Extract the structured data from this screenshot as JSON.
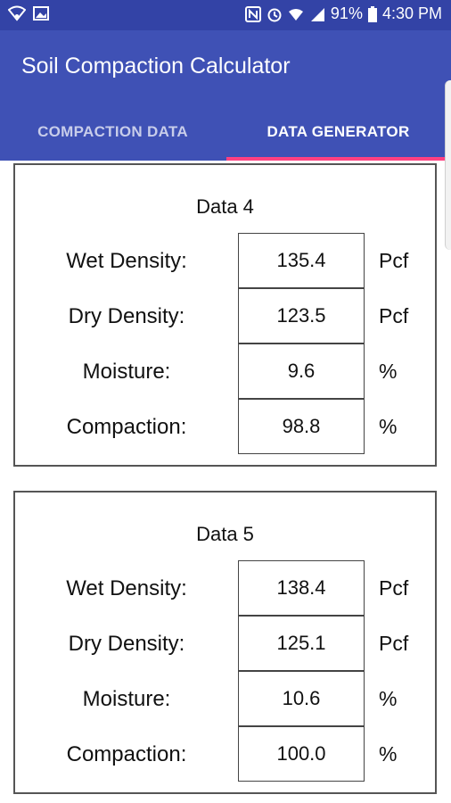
{
  "status_bar": {
    "battery_percent": "91%",
    "time": "4:30 PM",
    "icons_left": [
      "wifi-icon",
      "image-icon"
    ],
    "icons_right": [
      "nfc-icon",
      "alarm-icon",
      "wifi-signal-icon",
      "cell-signal-icon",
      "battery-icon"
    ]
  },
  "app": {
    "title": "Soil Compaction Calculator"
  },
  "tabs": [
    {
      "label": "COMPACTION DATA",
      "selected": false
    },
    {
      "label": "DATA GENERATOR",
      "selected": true
    }
  ],
  "colors": {
    "primary": "#3f51b5",
    "status": "#3343a6",
    "accent": "#ff4081"
  },
  "cards": [
    {
      "title": "Data 4",
      "rows": [
        {
          "label": "Wet Density:",
          "value": "135.4",
          "unit": "Pcf"
        },
        {
          "label": "Dry Density:",
          "value": "123.5",
          "unit": "Pcf"
        },
        {
          "label": "Moisture:",
          "value": "9.6",
          "unit": "%"
        },
        {
          "label": "Compaction:",
          "value": "98.8",
          "unit": "%"
        }
      ]
    },
    {
      "title": "Data 5",
      "rows": [
        {
          "label": "Wet Density:",
          "value": "138.4",
          "unit": "Pcf"
        },
        {
          "label": "Dry Density:",
          "value": "125.1",
          "unit": "Pcf"
        },
        {
          "label": "Moisture:",
          "value": "10.6",
          "unit": "%"
        },
        {
          "label": "Compaction:",
          "value": "100.0",
          "unit": "%"
        }
      ]
    }
  ]
}
